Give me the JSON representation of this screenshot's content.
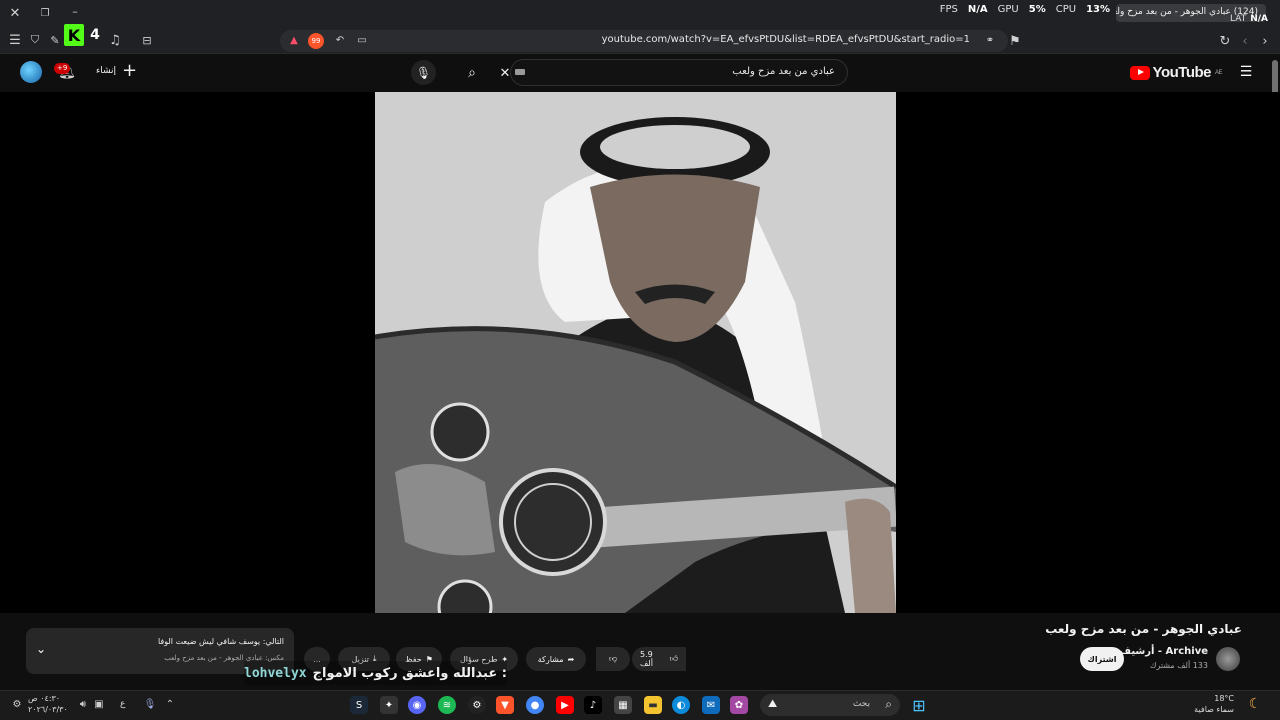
{
  "browser": {
    "url": "youtube.com/watch?v=EA_efvsPtDU&list=RDEA_efvsPtDU&start_radio=1",
    "tab_title": "(124) عبادي الجوهر - من بعد مزح ولعب",
    "hud": {
      "fps_label": "FPS",
      "fps_value": "N/A",
      "gpu_label": "GPU",
      "gpu_value": "5%",
      "cpu_label": "CPU",
      "cpu_value": "13%",
      "lat_label": "LAT",
      "lat_value": "N/A"
    }
  },
  "youtube": {
    "logo_text": "YouTube",
    "logo_region": "AE",
    "search_value": "عبادي من بعد مزح ولعب",
    "create_label": "إنشاء",
    "notifications_badge": "+9"
  },
  "video": {
    "title": "عبادي الجوهر - من بعد مزح ولعب",
    "channel": "Archive - أرشيف",
    "subscribers": "133 ألف مشترك",
    "subscribe_label": "اشتراك",
    "likes": "5.9 ألف",
    "share_label": "مشاركة",
    "ask_label": "طرح سؤال",
    "save_label": "حفظ",
    "download_label": "تنزيل",
    "more_label": "..."
  },
  "up_next": {
    "title": "التالي: يوسف شافي ليش ضيعت الوفا",
    "subtitle": "مكس: عبادي الجوهر - من بعد مزح ولعب"
  },
  "overlay_caption": {
    "user": "lohvelyx",
    "text": "عبدالله واعشق ركوب الامواج :"
  },
  "taskbar": {
    "search_placeholder": "بحث",
    "clock_time": "٠٤:٣٠ ص",
    "clock_date": "٢٠٢٦/٠٣/٣٠",
    "lang": "ع",
    "temperature": "18°C",
    "weather_desc": "سماء صافية"
  },
  "colors": {
    "yt_red": "#ff0000",
    "bg": "#0f0f0f",
    "pill": "#272727",
    "username": "#8fd6d6"
  }
}
